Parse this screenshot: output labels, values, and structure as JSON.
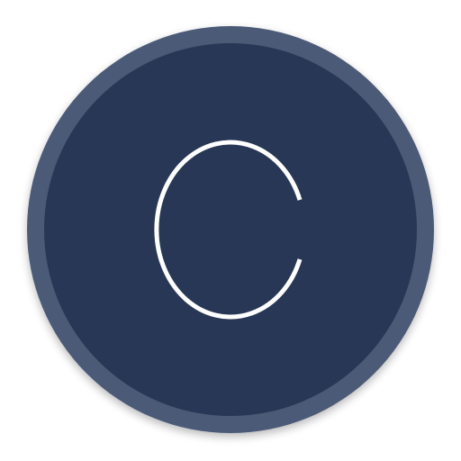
{
  "icon": {
    "semantic": "letter-c-icon",
    "glyph": "C",
    "colors": {
      "background": "#ffffff",
      "outer_ring": "#4b5a76",
      "inner_disc": "#283755",
      "glyph_stroke": "#ffffff",
      "shadow": "#000000"
    }
  }
}
